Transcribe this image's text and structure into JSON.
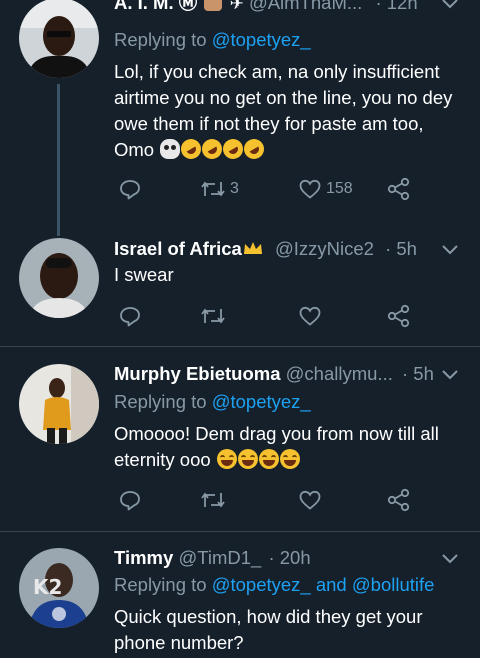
{
  "tweets": [
    {
      "name": "A. I. M. Ⓜ",
      "handle": "@AimThaM...",
      "time": "· 12h",
      "replying_label": "Replying to",
      "replying_to": "@topetyez_",
      "text": "Lol, if you check am, na only insufficient airtime you no get on the line, you no dey owe them if not they for paste am too, Omo",
      "retweets": "3",
      "likes": "158"
    },
    {
      "name": "Israel of Africa",
      "handle": "@IzzyNice2",
      "time": "· 5h",
      "text": "I swear"
    },
    {
      "name": "Murphy Ebietuoma",
      "handle": "@challymu...",
      "time": "· 5h",
      "replying_label": "Replying to",
      "replying_to": "@topetyez_",
      "text": "Omoooo! Dem drag you from now till all eternity ooo"
    },
    {
      "name": "Timmy",
      "handle": "@TimD1_",
      "time": "· 20h",
      "replying_label": "Replying to",
      "replying_to": "@topetyez_",
      "replying_and": "and",
      "replying_to_2": "@bollutife",
      "text": "Quick question, how did they get your phone number?"
    }
  ],
  "icons": {
    "reply": "reply-icon",
    "retweet": "retweet-icon",
    "like": "heart-icon",
    "share": "share-icon",
    "caret": "chevron-down-icon"
  },
  "colors": {
    "background": "#15202b",
    "muted": "#8899a6",
    "link": "#1da1f2",
    "divider": "#38444d"
  }
}
